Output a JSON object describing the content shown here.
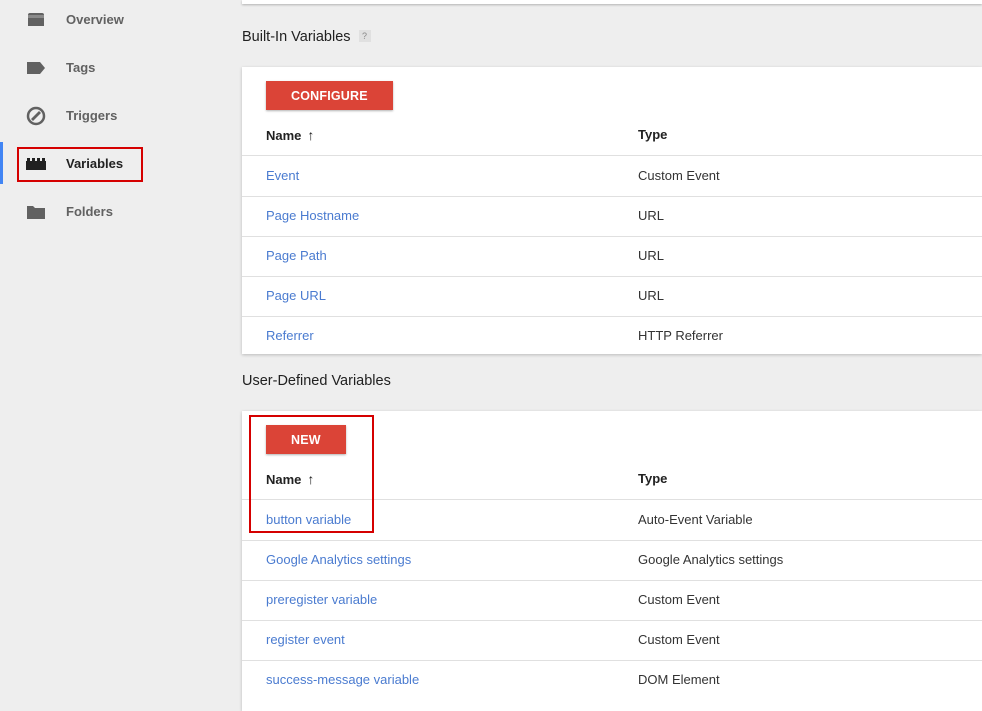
{
  "sidebar": {
    "items": [
      {
        "label": "Overview",
        "icon": "overview-icon"
      },
      {
        "label": "Tags",
        "icon": "tag-icon"
      },
      {
        "label": "Triggers",
        "icon": "trigger-icon"
      },
      {
        "label": "Variables",
        "icon": "variables-icon",
        "active": true
      },
      {
        "label": "Folders",
        "icon": "folder-icon"
      }
    ]
  },
  "builtin": {
    "title": "Built-In Variables",
    "help": "?",
    "button": "CONFIGURE",
    "col_name": "Name",
    "col_type": "Type",
    "sort": "↑",
    "rows": [
      {
        "name": "Event",
        "type": "Custom Event"
      },
      {
        "name": "Page Hostname",
        "type": "URL"
      },
      {
        "name": "Page Path",
        "type": "URL"
      },
      {
        "name": "Page URL",
        "type": "URL"
      },
      {
        "name": "Referrer",
        "type": "HTTP Referrer"
      }
    ]
  },
  "userdefined": {
    "title": "User-Defined Variables",
    "button": "NEW",
    "col_name": "Name",
    "col_type": "Type",
    "sort": "↑",
    "rows": [
      {
        "name": "button variable",
        "type": "Auto-Event Variable"
      },
      {
        "name": "Google Analytics settings",
        "type": "Google Analytics settings"
      },
      {
        "name": "preregister variable",
        "type": "Custom Event"
      },
      {
        "name": "register event",
        "type": "Custom Event"
      },
      {
        "name": "success-message variable",
        "type": "DOM Element"
      }
    ]
  },
  "colors": {
    "accent": "#4285f4",
    "button": "#db4437",
    "link": "#4a7bd0",
    "highlight": "#d50000"
  }
}
